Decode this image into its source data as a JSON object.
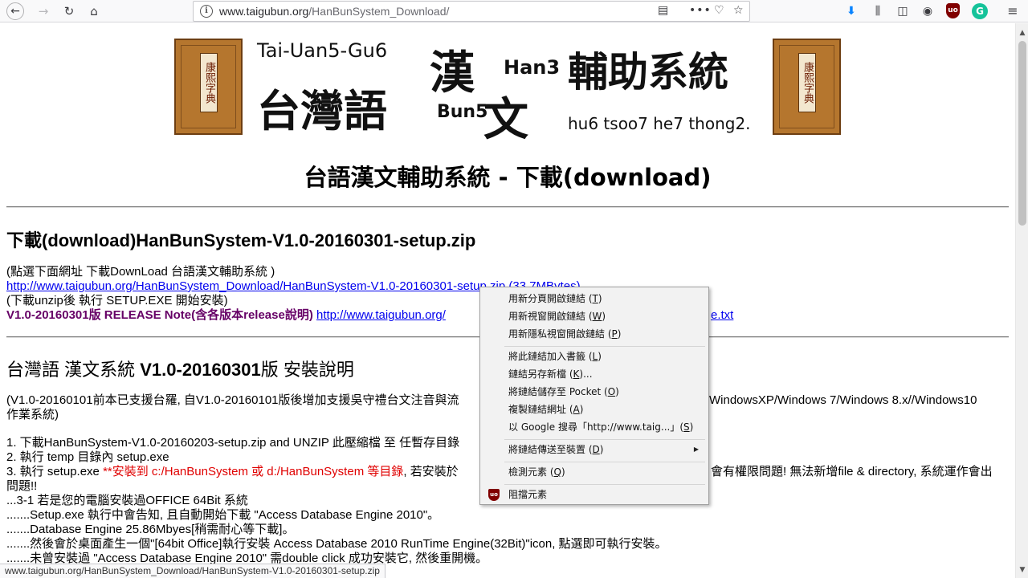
{
  "browser": {
    "url_host": "www.taigubun.org",
    "url_path": "/HanBunSystem_Download/",
    "icons": [
      "back-icon",
      "forward-icon",
      "reload-icon",
      "home-icon",
      "info-icon",
      "reader-view-icon",
      "page-actions-icon",
      "pocket-icon",
      "bookmark-star-icon",
      "download-icon",
      "library-icon",
      "sidebar-icon",
      "account-icon",
      "ublock-icon",
      "grammarly-icon",
      "menu-icon"
    ],
    "ublock_text": "uo",
    "grammarly_text": "G"
  },
  "banner": {
    "romanization_top": "Tai-Uan5-Gu6",
    "tai": "台灣語",
    "han": "漢",
    "han_roman": "Han3",
    "bun_roman": "Bun5",
    "bun": "文",
    "system": "輔助系統",
    "romanization_bottom": "hu6 tsoo7 he7 thong2.",
    "book_label": "康熙字典"
  },
  "page": {
    "title": "台語漢文輔助系統 - 下載(download)",
    "download_heading": "下載(download)HanBunSystem-V1.0-20160301-setup.zip",
    "click_hint": "(點選下面網址 下載DownLoad 台語漢文輔助系統 )",
    "download_link": "http://www.taigubun.org/HanBunSystem_Download/HanBunSystem-V1.0-20160301-setup.zip (33.7MBytes)",
    "after_unzip": "(下載unzip後 執行 SETUP.EXE 開始安裝)",
    "release_note_label": "V1.0-20160301版 RELEASE Note(含各版本release說明)",
    "release_note_link_start": "http://www.taigubun.org/",
    "release_note_link_end": "e.txt",
    "install_heading_plain": "台灣語 漢文系統 ",
    "install_heading_bold": "V1.0-20160301",
    "install_heading_tail": "版 安裝說明",
    "intro_left": "(V1.0-20160101前本已支援台羅, 自V1.0-20160101版後增加支援吳守禮台文注音與流",
    "intro_right": "WindowsXP/Windows 7/Windows 8.x//Windows10",
    "intro_line2": "作業系統)",
    "step1": "1. 下載HanBunSystem-V1.0-20160203-setup.zip and UNZIP 此壓縮檔 至 任暫存目錄",
    "step2": "2. 執行 temp 目錄內 setup.exe",
    "step3_prefix": "3. 執行 setup.exe ",
    "step3_red": "**安裝到 c:/HanBunSystem 或 d:/HanBunSystem 等目錄",
    "step3_mid": ", 若安裝於",
    "step3_right": "會有權限問題! 無法新增file & directory, 系統運作會出",
    "step3_line2": "問題!!",
    "step31": "...3-1 若是您的電腦安裝過OFFICE 64Bit 系統",
    "step31a": ".......Setup.exe 執行中會告知, 且自動開始下載 \"Access Database Engine 2010\"。",
    "step31b": ".......Database Engine 25.86Mbyes[稍需耐心等下載]。",
    "step31c": ".......然後會於桌面產生一個\"[64bit Office]執行安裝 Access Database 2010 RunTime Engine(32Bit)\"icon, 點選即可執行安裝。",
    "step31d": ".......未曾安裝過 \"Access Database Engine 2010\" 需double click 成功安裝它, 然後重開機。"
  },
  "status_bar": "www.taigubun.org/HanBunSystem_Download/HanBunSystem-V1.0-20160301-setup.zip",
  "context_menu": {
    "items": [
      {
        "label": "用新分頁開啟鏈結 ",
        "key": "T"
      },
      {
        "label": "用新視窗開啟鏈結 ",
        "key": "W"
      },
      {
        "label": "用新隱私視窗開啟鏈結 ",
        "key": "P"
      },
      {
        "label": "將此鏈結加入書籤 ",
        "key": "L"
      },
      {
        "label": "鏈結另存新檔 ",
        "key": "K",
        "suffix": "..."
      },
      {
        "label": "將鏈結儲存至 Pocket ",
        "key": "O"
      },
      {
        "label": "複製鏈結網址 ",
        "key": "A"
      },
      {
        "label": "以 Google 搜尋「http://www.taig...」",
        "key": "S"
      },
      {
        "label": "將鏈結傳送至裝置 ",
        "key": "D"
      },
      {
        "label": "檢測元素 ",
        "key": "Q"
      },
      {
        "label": "阻擋元素"
      }
    ]
  }
}
